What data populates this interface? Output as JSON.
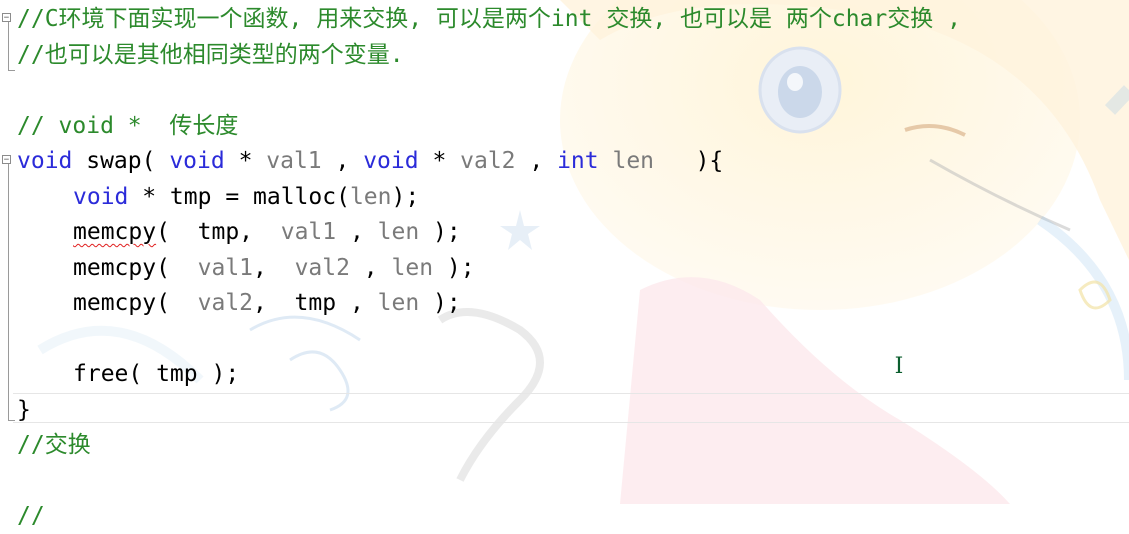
{
  "editor": {
    "lines": [
      {
        "tokens": [
          {
            "t": "cm",
            "v": "//C环境下面实现一个函数, 用来交换, 可以是两个int 交换, 也可以是 两个char交换 ,"
          }
        ]
      },
      {
        "tokens": [
          {
            "t": "cm",
            "v": "//也可以是其他相同类型的两个变量."
          }
        ]
      },
      {
        "tokens": []
      },
      {
        "tokens": [
          {
            "t": "cm",
            "v": "// void *  传长度"
          }
        ]
      },
      {
        "tokens": [
          {
            "t": "kw",
            "v": "void"
          },
          {
            "t": "tx",
            "v": " swap( "
          },
          {
            "t": "kw",
            "v": "void"
          },
          {
            "t": "tx",
            "v": " * "
          },
          {
            "t": "pm",
            "v": "val1"
          },
          {
            "t": "tx",
            "v": " , "
          },
          {
            "t": "kw",
            "v": "void"
          },
          {
            "t": "tx",
            "v": " * "
          },
          {
            "t": "pm",
            "v": "val2"
          },
          {
            "t": "tx",
            "v": " , "
          },
          {
            "t": "kw",
            "v": "int"
          },
          {
            "t": "tx",
            "v": " "
          },
          {
            "t": "pm",
            "v": "len"
          },
          {
            "t": "tx",
            "v": "   ){"
          }
        ]
      },
      {
        "indent": 1,
        "tokens": [
          {
            "t": "kw",
            "v": "void"
          },
          {
            "t": "tx",
            "v": " * tmp = malloc("
          },
          {
            "t": "pm",
            "v": "len"
          },
          {
            "t": "tx",
            "v": ");"
          }
        ]
      },
      {
        "indent": 1,
        "tokens": [
          {
            "t": "tx",
            "v": "memcpy",
            "err": true
          },
          {
            "t": "tx",
            "v": "(  tmp,  "
          },
          {
            "t": "pm",
            "v": "val1"
          },
          {
            "t": "tx",
            "v": " , "
          },
          {
            "t": "pm",
            "v": "len"
          },
          {
            "t": "tx",
            "v": " );"
          }
        ]
      },
      {
        "indent": 1,
        "tokens": [
          {
            "t": "tx",
            "v": "memcpy(  "
          },
          {
            "t": "pm",
            "v": "val1"
          },
          {
            "t": "tx",
            "v": ",  "
          },
          {
            "t": "pm",
            "v": "val2"
          },
          {
            "t": "tx",
            "v": " , "
          },
          {
            "t": "pm",
            "v": "len"
          },
          {
            "t": "tx",
            "v": " );"
          }
        ]
      },
      {
        "indent": 1,
        "tokens": [
          {
            "t": "tx",
            "v": "memcpy(  "
          },
          {
            "t": "pm",
            "v": "val2"
          },
          {
            "t": "tx",
            "v": ",  tmp , "
          },
          {
            "t": "pm",
            "v": "len"
          },
          {
            "t": "tx",
            "v": " );"
          }
        ]
      },
      {
        "tokens": []
      },
      {
        "indent": 1,
        "tokens": [
          {
            "t": "tx",
            "v": "free( tmp );"
          }
        ]
      },
      {
        "tokens": [
          {
            "t": "tx",
            "v": "}"
          }
        ]
      },
      {
        "tokens": [
          {
            "t": "cm",
            "v": "//交换"
          }
        ]
      },
      {
        "tokens": []
      },
      {
        "tokens": [
          {
            "t": "cm",
            "v": "//"
          }
        ]
      }
    ]
  },
  "colors": {
    "comment": "#2c8a2c",
    "keyword": "#2b2bd9",
    "param": "#7a7a7a",
    "text": "#000000",
    "error_underline": "#e02020"
  },
  "icons": {
    "fold": "fold-collapse-icon",
    "cursor": "text-ibeam-cursor-icon"
  }
}
